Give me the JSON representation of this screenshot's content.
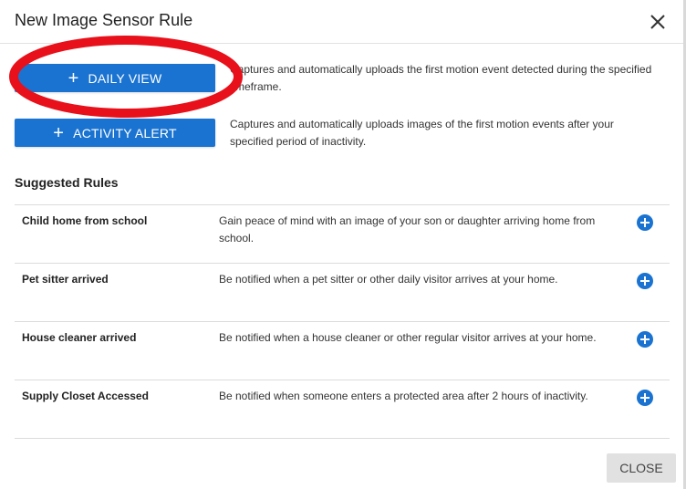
{
  "dialog": {
    "title": "New Image Sensor Rule",
    "close_icon": "close-icon"
  },
  "actions": [
    {
      "label": "DAILY VIEW",
      "icon": "plus-icon",
      "description": "Captures and automatically uploads the first motion event detected during the specified timeframe."
    },
    {
      "label": "ACTIVITY ALERT",
      "icon": "plus-icon",
      "description": "Captures and automatically uploads images of the first motion events after your specified period of inactivity."
    }
  ],
  "suggested": {
    "title": "Suggested Rules",
    "rules": [
      {
        "name": "Child home from school",
        "description": "Gain peace of mind with an image of your son or daughter arriving home from school."
      },
      {
        "name": "Pet sitter arrived",
        "description": "Be notified when a pet sitter or other daily visitor arrives at your home."
      },
      {
        "name": "House cleaner arrived",
        "description": "Be notified when a house cleaner or other regular visitor arrives at your home."
      },
      {
        "name": "Supply Closet Accessed",
        "description": "Be notified when someone enters a protected area after 2 hours of inactivity."
      }
    ],
    "add_icon": "plus-circle-icon"
  },
  "footer": {
    "close_label": "CLOSE"
  },
  "colors": {
    "accent": "#1a73d1",
    "annotation": "#e8101a",
    "close_bg": "#e1e1e1"
  }
}
